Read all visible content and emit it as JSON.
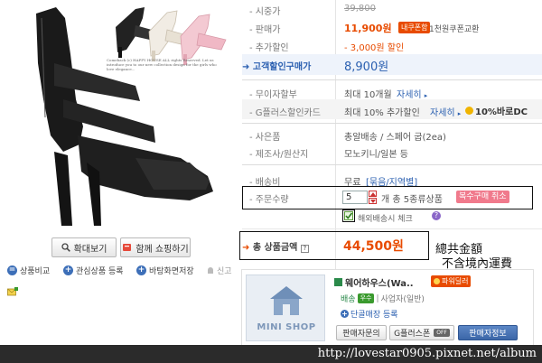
{
  "product": {
    "caption": "Comeback (c) HAPPY HOUSE ALL rights Reserved. Let us introduce you to our new collection design for the girls who love elegance...",
    "zoom_button": "확대보기",
    "cart_button": "함께 쇼핑하기",
    "links": {
      "compare": "상품비교",
      "wishlist": "관심상품 등록",
      "save_desktop": "바탕화면저장",
      "report": "신고"
    }
  },
  "price_info": {
    "market_price_label": "시중가",
    "market_price": "39,800",
    "sale_price_label": "판매가",
    "sale_price": "11,900원",
    "coupon_badge": "내쿠폰함",
    "coupon_note": "1천원쿠폰교환",
    "discount_label": "추가할인",
    "discount_value": "- 3,000원 할인",
    "customer_price_label": "고객할인구매가",
    "customer_price": "8,900원",
    "installment_label": "무이자할부",
    "installment_value": "최대 10개월",
    "installment_link": "자세히",
    "card_label": "G플러스할인카드",
    "card_value": "최대 10% 추가할인",
    "card_link": "자세히",
    "card_badge": "10%바로DC",
    "gift_label": "사은품",
    "gift_value": "총알배송 / 스페어 굽(2ea)",
    "origin_label": "제조사/원산지",
    "origin_value": "모노키니/일본 등",
    "shipping_label": "배송비",
    "shipping_value": "무료",
    "shipping_link": "[묶음/지역별]",
    "qty_label": "주문수량",
    "qty_value": "5",
    "qty_suffix": "개 총 5종류상품",
    "qty_button": "복수구매 취소",
    "overseas_label": "해외배송시 체크",
    "total_label": "총 상품금액",
    "total_value": "44,500원"
  },
  "annotation": {
    "line1": "總共金額",
    "line2": "不含境內運費"
  },
  "store": {
    "name": "웨어하우스(Wa..",
    "power_badge": "파워딜러",
    "shipping_tag": "배송",
    "grade_tag": "우수",
    "biz_type": "사업자(일반)",
    "favorite": "단골매장 등록",
    "logo_text": "MINI SHOP",
    "contact_button": "판매자문의",
    "gstamp_button": "G플러스폰",
    "gstamp_badge": "OFF",
    "seller_button": "판매자정보"
  },
  "watermark": "http://lovestar0905.pixnet.net/album",
  "colors": {
    "accent_orange": "#e84b00",
    "link_blue": "#2a5fb0",
    "watermark_bg": "#2b2b2b"
  }
}
